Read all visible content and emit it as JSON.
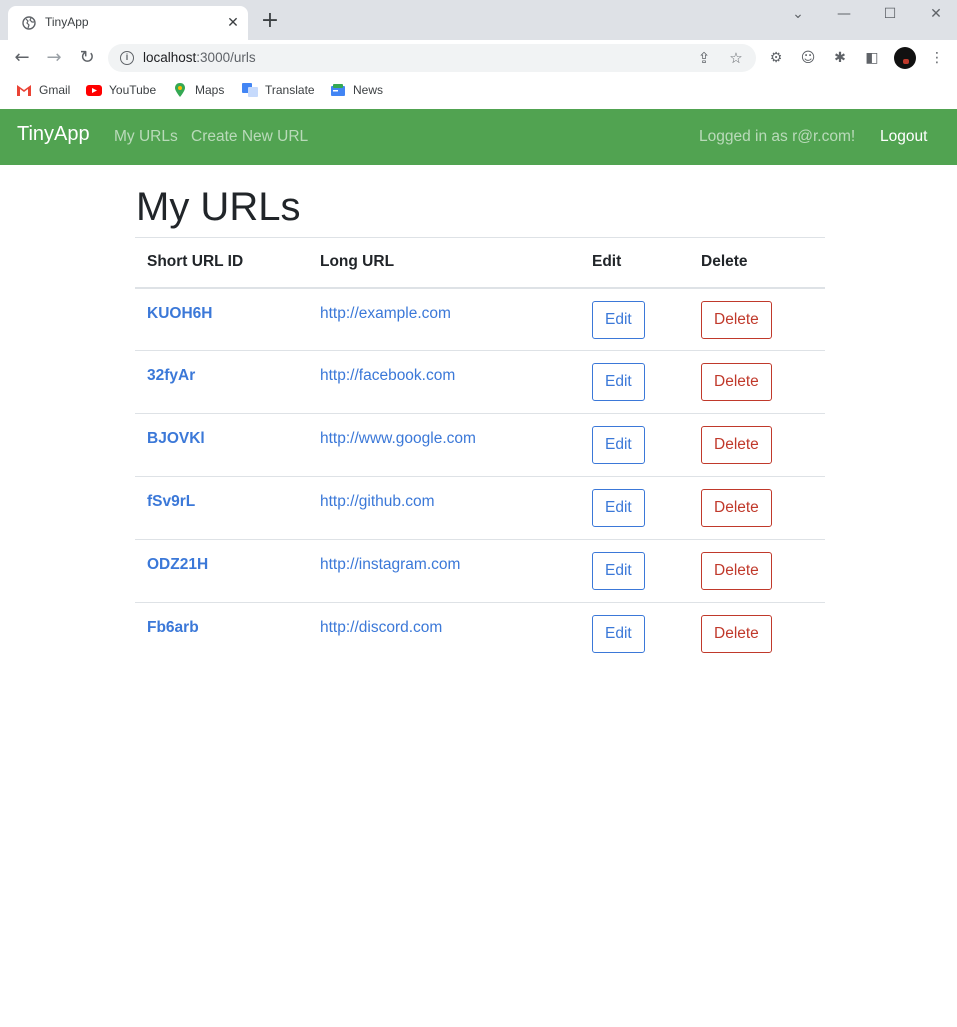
{
  "browser": {
    "tab_title": "TinyApp",
    "url_host": "localhost",
    "url_path": ":3000/urls",
    "bookmarks": [
      {
        "label": "Gmail",
        "icon": "gmail-icon"
      },
      {
        "label": "YouTube",
        "icon": "youtube-icon"
      },
      {
        "label": "Maps",
        "icon": "maps-icon"
      },
      {
        "label": "Translate",
        "icon": "translate-icon"
      },
      {
        "label": "News",
        "icon": "news-icon"
      }
    ]
  },
  "navbar": {
    "brand": "TinyApp",
    "links": [
      "My URLs",
      "Create New URL"
    ],
    "logged_in_text": "Logged in as r@r.com!",
    "logout_label": "Logout"
  },
  "page": {
    "title": "My URLs",
    "columns": [
      "Short URL ID",
      "Long URL",
      "Edit",
      "Delete"
    ],
    "edit_label": "Edit",
    "delete_label": "Delete",
    "rows": [
      {
        "id": "KUOH6H",
        "long_url": "http://example.com",
        "edit": "Edit",
        "delete": "Delete"
      },
      {
        "id": "32fyAr",
        "long_url": "http://facebook.com",
        "edit": "Edit",
        "delete": "Delete"
      },
      {
        "id": "BJOVKl",
        "long_url": "http://www.google.com",
        "edit": "Edit",
        "delete": "Delete"
      },
      {
        "id": "fSv9rL",
        "long_url": "http://github.com",
        "edit": "Edit",
        "delete": "Delete"
      },
      {
        "id": "ODZ21H",
        "long_url": "http://instagram.com",
        "edit": "Edit",
        "delete": "Delete"
      },
      {
        "id": "Fb6arb",
        "long_url": "http://discord.com",
        "edit": "Edit",
        "delete": "Delete"
      }
    ]
  },
  "colors": {
    "navbar_bg": "#51a351",
    "link": "#3b78d8",
    "danger": "#c0392b"
  }
}
